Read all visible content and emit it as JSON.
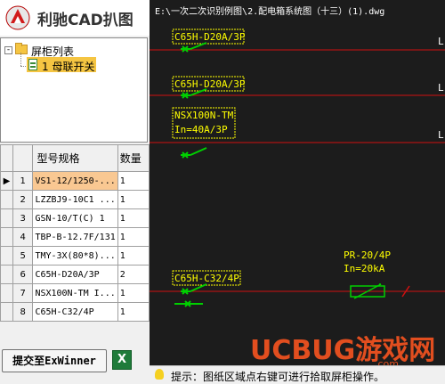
{
  "app": {
    "title": "利驰CAD扒图"
  },
  "tree": {
    "root_label": "屏柜列表",
    "root_expander": "-",
    "child_label": "1 母联开关"
  },
  "grid": {
    "headers": [
      "型号规格",
      "数量"
    ],
    "rows": [
      {
        "n": "1",
        "model": "VS1-12/1250-...",
        "qty": "1",
        "current": true
      },
      {
        "n": "2",
        "model": "LZZBJ9-10C1 ...",
        "qty": "1"
      },
      {
        "n": "3",
        "model": "GSN-10/T(C) 1",
        "qty": "1"
      },
      {
        "n": "4",
        "model": "TBP-B-12.7F/131",
        "qty": "1"
      },
      {
        "n": "5",
        "model": "TMY-3X(80*8)...",
        "qty": "1"
      },
      {
        "n": "6",
        "model": "C65H-D20A/3P",
        "qty": "2"
      },
      {
        "n": "7",
        "model": "NSX100N-TM I...",
        "qty": "1"
      },
      {
        "n": "8",
        "model": "C65H-C32/4P",
        "qty": "1"
      }
    ],
    "current_row_marker": "▶"
  },
  "buttons": {
    "submit": "提交至ExWinner",
    "excel": "X"
  },
  "cad": {
    "path": "E:\\一次二次识别例图\\2.配电箱系统图（十三）(1).dwg",
    "labels": {
      "l1": "C65H-D20A/3P",
      "l2": "C65H-D20A/3P",
      "l3a": "NSX100N-TM",
      "l3b": "In=40A/3P",
      "l4": "C65H-C32/4P",
      "l5a": "PR-20/4P",
      "l5b": "In=20kA"
    },
    "edge_letters": [
      "L",
      "L",
      "L"
    ]
  },
  "status": {
    "hint": "提示：图纸区域点右键可进行拾取屏柜操作。"
  },
  "watermark": {
    "main": "UCBUG游戏网",
    "sub": ".com"
  },
  "colors": {
    "selection": "#f5c542",
    "cad_bg": "#1c1c1c",
    "cad_label": "#ffff00",
    "cad_line_green": "#00d000",
    "cad_line_red": "#d01010"
  }
}
